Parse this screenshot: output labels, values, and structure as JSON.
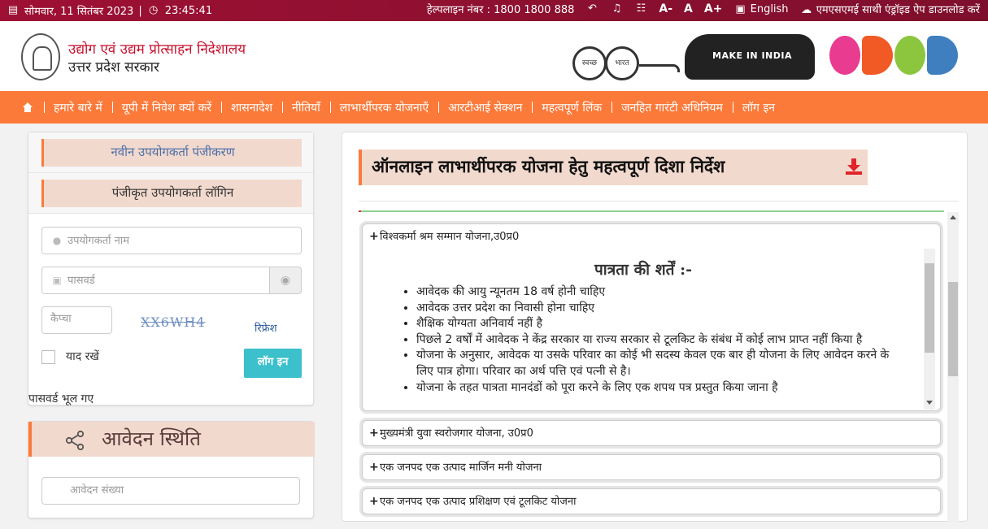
{
  "topbar": {
    "date": "सोमवार, 11 सितंबर 2023",
    "separator": "|",
    "time": "23:45:41",
    "helpline": "हेल्पलाइन नंबर : 1800 1800 888",
    "font_small": "A-",
    "font_normal": "A",
    "font_large": "A+",
    "language": "English",
    "app_download": "एमएसएमई साथी एंड्रॉइड ऐप डाउनलोड करें"
  },
  "header": {
    "dept_line1": "उद्योग एवं उद्यम प्रोत्साहन निदेशालय",
    "dept_line2": "उत्तर प्रदेश सरकार",
    "swachh_1": "स्वच्छ",
    "swachh_2": "भारत",
    "make_in_india": "MAKE IN INDIA"
  },
  "nav": {
    "items": [
      "हमारे बारे में",
      "यूपी में निवेश क्यों करें",
      "शासनादेश",
      "नीतियाँ",
      "लाभार्थीपरक योजनाएँ",
      "आरटीआई सेक्शन",
      "महत्वपूर्ण लिंक",
      "जनहित गारंटी अधिनियम",
      "लॉग इन"
    ]
  },
  "login": {
    "tab_new": "नवीन उपयोगकर्ता पंजीकरण",
    "tab_registered": "पंजीकृत उपयोगकर्ता लॉगिन",
    "username_placeholder": "उपयोगकर्ता नाम",
    "password_placeholder": "पासवर्ड",
    "captcha_placeholder": "कैप्चा",
    "captcha_text": "XX6WH4",
    "refresh": "रिफ्रेश",
    "remember": "याद रखें",
    "login_button": "लॉग इन",
    "forgot": "पासवर्ड भूल गए"
  },
  "status": {
    "title": "आवेदन स्थिति",
    "application_no_placeholder": "आवेदन संख्या"
  },
  "main": {
    "title": "ऑनलाइन लाभार्थीपरक योजना हेतु महत्वपूर्ण दिशा निर्देश",
    "accordions": [
      {
        "label": "विश्वकर्मा श्रम सम्मान योजना,उ0प्र0"
      },
      {
        "label": "मुख्यमंत्री युवा स्वरोजगार योजना, उ0प्र0"
      },
      {
        "label": "एक जनपद एक उत्पाद मार्जिन मनी योजना"
      },
      {
        "label": "एक जनपद एक उत्पाद प्रशिक्षण एवं टूलकिट योजना"
      }
    ],
    "eligibility_title": "पात्रता की शर्तें :-",
    "criteria": [
      "आवेदक की आयु न्यूनतम 18 वर्ष होनी चाहिए",
      "आवेदक उत्तर प्रदेश का निवासी होना चाहिए",
      "शैक्षिक योग्यता अनिवार्य नहीं है",
      "पिछले 2 वर्षों में आवेदक ने केंद्र सरकार या राज्य सरकार से टूलकिट के संबंध में कोई लाभ प्राप्त नहीं किया है",
      "योजना के अनुसार, आवेदक या उसके परिवार का कोई भी सदस्य केवल एक बार ही योजना के लिए आवेदन करने के लिए पात्र होगा। परिवार का अर्थ पत्ति एवं पत्नी से है।",
      "योजना के तहत पात्रता मानदंडों को पूरा करने के लिए एक शपथ पत्र प्रस्तुत किया जाना है"
    ]
  },
  "colors": {
    "topbar": "#9e1034",
    "nav": "#fb7a3a",
    "tab_bg": "#f2d9cd",
    "login_button": "#3bc0cc"
  }
}
